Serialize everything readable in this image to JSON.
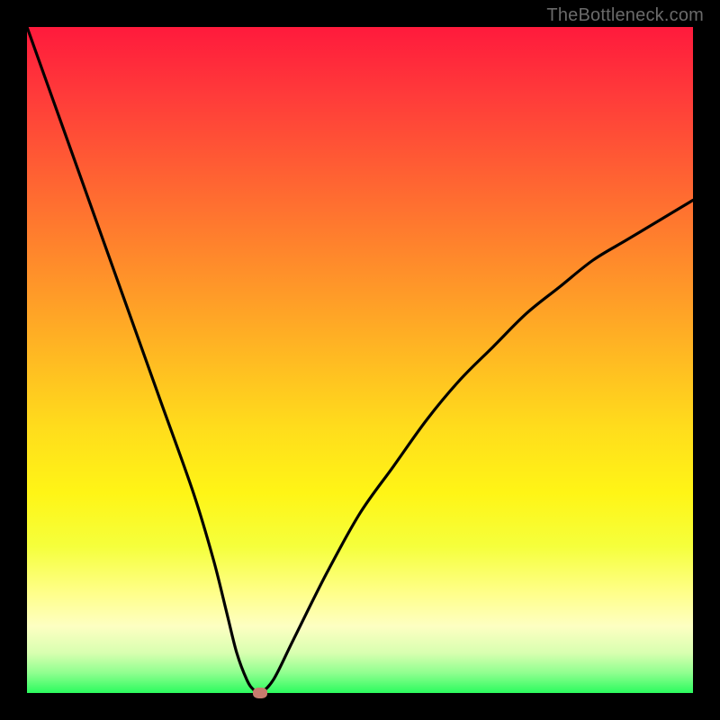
{
  "watermark": "TheBottleneck.com",
  "chart_data": {
    "type": "line",
    "title": "",
    "xlabel": "",
    "ylabel": "",
    "xlim": [
      0,
      100
    ],
    "ylim": [
      0,
      100
    ],
    "grid": false,
    "legend": false,
    "series": [
      {
        "name": "bottleneck-curve",
        "x": [
          0,
          5,
          10,
          15,
          20,
          25,
          28,
          30,
          31.5,
          33,
          34,
          35,
          37,
          40,
          45,
          50,
          55,
          60,
          65,
          70,
          75,
          80,
          85,
          90,
          95,
          100
        ],
        "y": [
          100,
          86,
          72,
          58,
          44,
          30,
          20,
          12,
          6,
          2,
          0.5,
          0,
          2,
          8,
          18,
          27,
          34,
          41,
          47,
          52,
          57,
          61,
          65,
          68,
          71,
          74
        ]
      }
    ],
    "marker": {
      "x": 35,
      "y": 0
    },
    "gradient_stops": [
      {
        "pos": 0,
        "color": "#ff1a3c"
      },
      {
        "pos": 50,
        "color": "#ffdc1c"
      },
      {
        "pos": 100,
        "color": "#2bfb5e"
      }
    ]
  }
}
